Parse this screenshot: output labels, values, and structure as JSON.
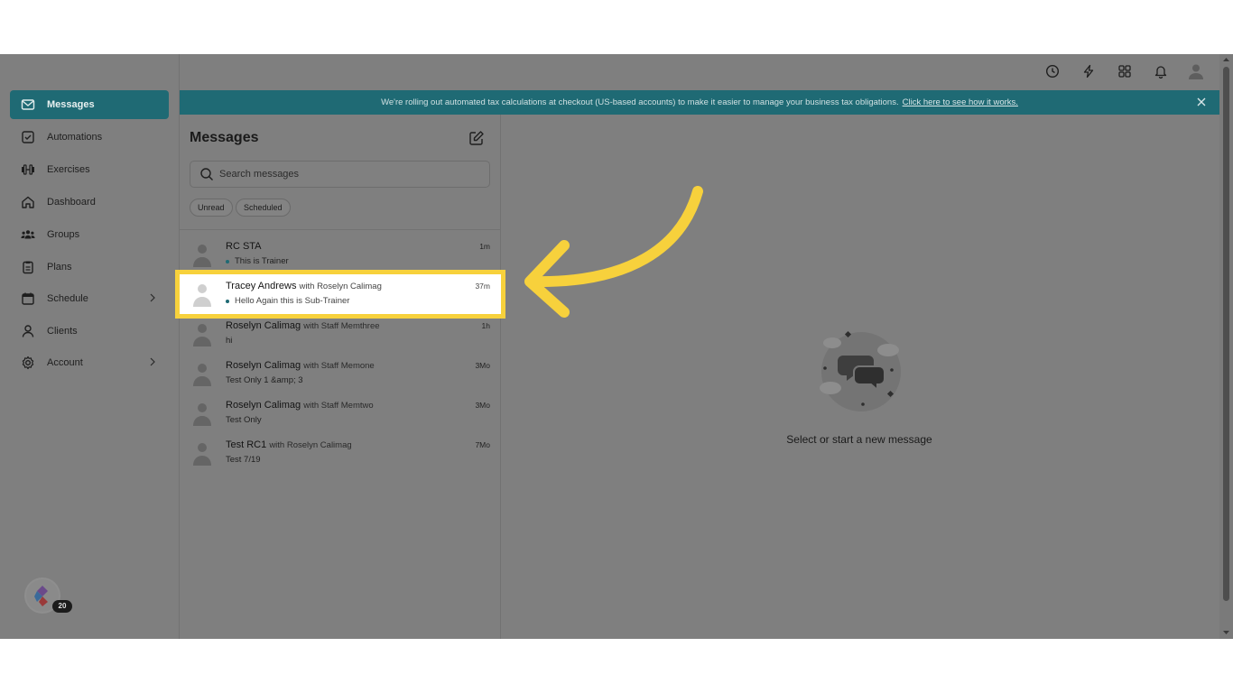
{
  "sidebar": {
    "items": [
      {
        "label": "Messages",
        "icon": "envelope-icon",
        "active": true
      },
      {
        "label": "Automations",
        "icon": "checkbox-icon"
      },
      {
        "label": "Exercises",
        "icon": "dumbbell-icon"
      },
      {
        "label": "Dashboard",
        "icon": "home-icon"
      },
      {
        "label": "Groups",
        "icon": "users-icon"
      },
      {
        "label": "Plans",
        "icon": "clipboard-icon"
      },
      {
        "label": "Schedule",
        "icon": "calendar-icon",
        "has_submenu": true
      },
      {
        "label": "Clients",
        "icon": "user-icon"
      },
      {
        "label": "Account",
        "icon": "gear-icon",
        "has_submenu": true
      }
    ],
    "helper_badge": "20"
  },
  "banner": {
    "text": "We're rolling out automated tax calculations at checkout (US-based accounts) to make it easier to manage your business tax obligations.",
    "link_text": "Click here to see how it works."
  },
  "messages": {
    "title": "Messages",
    "search_placeholder": "Search messages",
    "filters": [
      "Unread",
      "Scheduled"
    ],
    "threads": [
      {
        "name": "RC STA",
        "with": "",
        "preview": "This is Trainer",
        "time": "1m",
        "unread": true
      },
      {
        "name": "Tracey Andrews",
        "with": "with Roselyn Calimag",
        "preview": "Hello Again this is Sub-Trainer",
        "time": "37m",
        "unread": true,
        "highlighted": true
      },
      {
        "name": "Roselyn Calimag",
        "with": "with Staff Memthree",
        "preview": "hi",
        "time": "1h",
        "unread": false
      },
      {
        "name": "Roselyn Calimag",
        "with": "with Staff Memone",
        "preview": "Test Only 1 &amp; 3",
        "time": "3Mo",
        "unread": false
      },
      {
        "name": "Roselyn Calimag",
        "with": "with Staff Memtwo",
        "preview": "Test Only",
        "time": "3Mo",
        "unread": false
      },
      {
        "name": "Test RC1",
        "with": "with Roselyn Calimag",
        "preview": "Test 7/19",
        "time": "7Mo",
        "unread": false
      }
    ]
  },
  "empty_state": {
    "text": "Select or start a new message"
  },
  "colors": {
    "accent": "#1f6a74",
    "highlight": "#f7d13c",
    "overlay": "#7f7f7f"
  }
}
